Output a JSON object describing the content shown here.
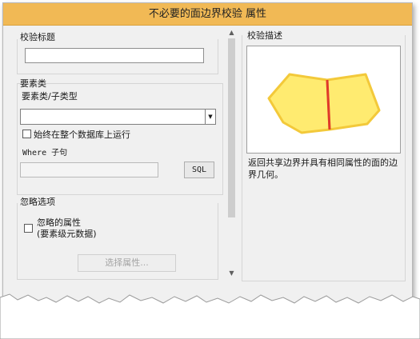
{
  "window": {
    "title": "不必要的面边界校验 属性"
  },
  "left": {
    "check_title_label": "校验标题",
    "check_title_value": "",
    "feature_class_group": "要素类",
    "feature_subtype_label": "要素类/子类型",
    "feature_subtype_value": "",
    "run_on_entire_db_label": "始终在整个数据库上运行",
    "run_on_entire_db_checked": false,
    "where_label": "Where 子句",
    "where_value": "",
    "sql_button": "SQL",
    "ignore_group": "忽略选项",
    "ignored_attributes_label": "忽略的属性",
    "ignored_attributes_sublabel": "(要素级元数据)",
    "ignored_attributes_checked": false,
    "select_attributes_button": "选择属性..."
  },
  "right": {
    "description_label": "校验描述",
    "description_text": "返回共享边界并具有相同属性的面的边界几何。"
  },
  "icons": {
    "dropdown": "chevron-down-icon",
    "scroll_up": "chevron-up-icon",
    "scroll_down": "chevron-down-icon"
  },
  "colors": {
    "title_bar": "#f1b955",
    "polygon_fill": "#ffeb70",
    "polygon_stroke": "#f3c93a",
    "shared_boundary": "#e0392b"
  }
}
